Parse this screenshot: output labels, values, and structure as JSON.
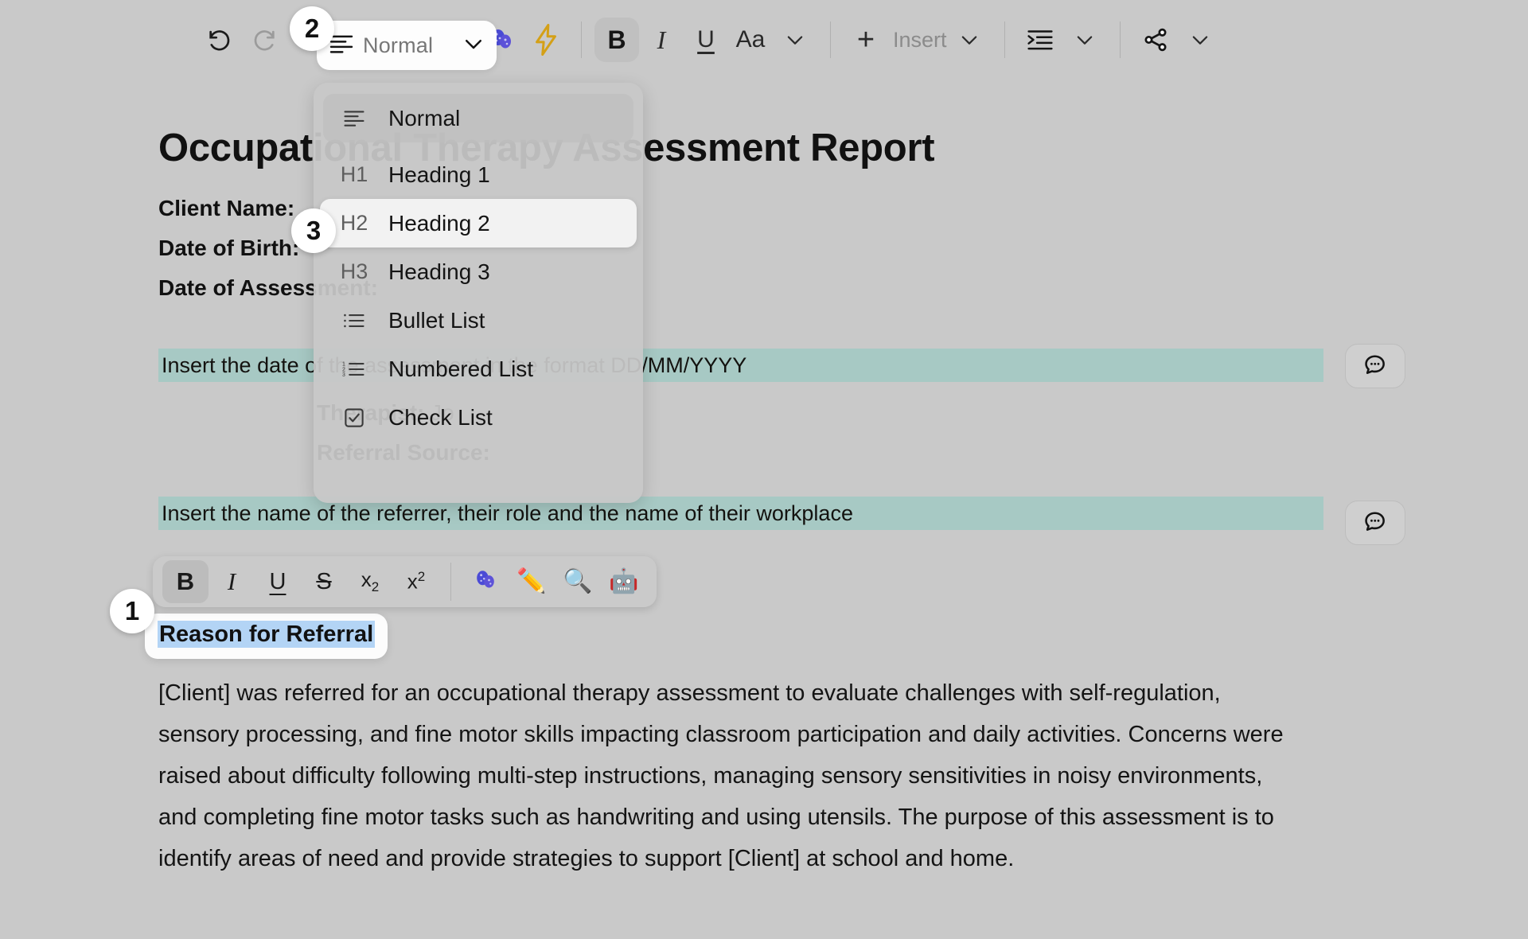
{
  "toolbar": {
    "undo_icon": "undo-icon",
    "redo_icon": "redo-icon",
    "style_label": "Normal",
    "style_icon": "paragraph-lines-icon",
    "chevron_icon": "chevron-down-icon",
    "ai_icon": "ai-blobs-icon",
    "lightning_icon": "lightning-bolt-icon",
    "bold_label": "B",
    "italic_label": "I",
    "underline_label": "U",
    "font_label": "Aa",
    "insert_plus": "+",
    "insert_label": "Insert",
    "indent_icon": "indent-icon",
    "share_icon": "share-icon"
  },
  "style_menu": {
    "items": [
      {
        "icon": "paragraph-lines-icon",
        "glyph": "",
        "label": "Normal",
        "state": "current"
      },
      {
        "icon": "h1-icon",
        "glyph": "H1",
        "label": "Heading 1",
        "state": "normal"
      },
      {
        "icon": "h2-icon",
        "glyph": "H2",
        "label": "Heading 2",
        "state": "hovered"
      },
      {
        "icon": "h3-icon",
        "glyph": "H3",
        "label": "Heading 3",
        "state": "normal"
      },
      {
        "icon": "bullet-list-icon",
        "glyph": "",
        "label": "Bullet List",
        "state": "normal"
      },
      {
        "icon": "numbered-list-icon",
        "glyph": "",
        "label": "Numbered List",
        "state": "normal"
      },
      {
        "icon": "check-list-icon",
        "glyph": "",
        "label": "Check List",
        "state": "normal"
      }
    ]
  },
  "document": {
    "title": "Occupational Therapy Assessment Report",
    "meta": [
      {
        "label": "Client Name:",
        "value": ""
      },
      {
        "label": "Date of Birth:",
        "value": ""
      },
      {
        "label": "Date of Assessment:",
        "value": ""
      }
    ],
    "teal_row_1": "Insert the date of the assessment in the format DD/MM/YYYY",
    "therapist_label": "Therapist:",
    "therapist_value": "Jo",
    "referral_label": "Referral Source:",
    "teal_row_2": "Insert the name of the referrer, their role and the name of their workplace",
    "selected_heading": "Reason for Referral",
    "paragraph": "[Client] was referred for an occupational therapy assessment to evaluate challenges with self-regulation, sensory processing, and fine motor skills impacting classroom participation and daily activities. Concerns were raised about difficulty following multi-step instructions, managing sensory sensitivities in noisy environments, and completing fine motor tasks such as handwriting and using utensils. The purpose of this assessment is to identify areas of need and provide strategies to support [Client] at school and home.",
    "comment_icon": "comment-bubble-icon"
  },
  "selection_toolbar": {
    "bold": "B",
    "italic": "I",
    "underline": "U",
    "strikethrough": "S",
    "subscript_base": "x",
    "subscript_sub": "2",
    "superscript_base": "x",
    "superscript_sup": "2",
    "ai_icon": "ai-blobs-icon",
    "pencil_icon": "pencil-icon",
    "search_icon": "magnifier-icon",
    "robot_icon": "robot-icon"
  },
  "badges": [
    {
      "number": "1"
    },
    {
      "number": "2"
    },
    {
      "number": "3"
    }
  ],
  "colors": {
    "background": "#c9c9c9",
    "teal_highlight": "#a7c9c4",
    "text_selection": "#b3d4f5",
    "accent_purple": "#4b4bd6",
    "accent_gold": "#d4a017"
  }
}
